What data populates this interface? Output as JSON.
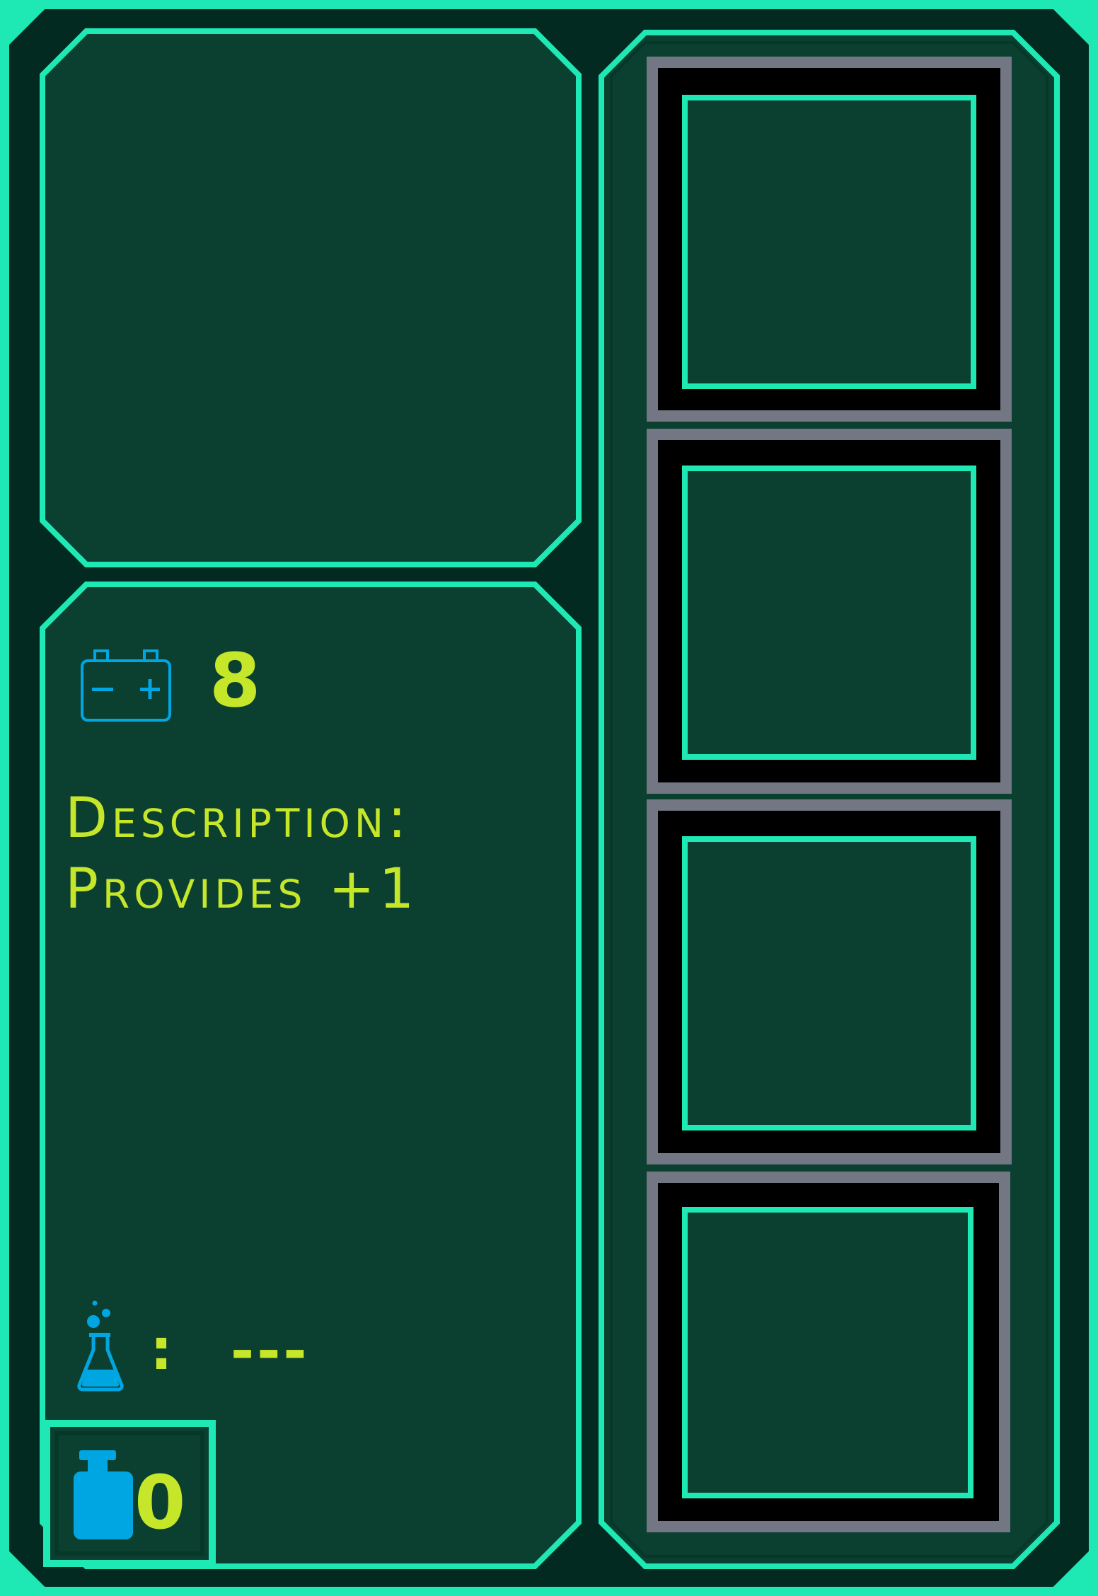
{
  "card": {
    "energy": {
      "icon": "battery-icon",
      "value": "8"
    },
    "description": {
      "label": "Description:",
      "text": "Provides +1"
    },
    "research": {
      "icon": "flask-icon",
      "separator": ":",
      "value": "---"
    },
    "mass": {
      "icon": "weight-icon",
      "value": "0"
    }
  },
  "slots": [
    {
      "name": "slot-1"
    },
    {
      "name": "slot-2"
    },
    {
      "name": "slot-3"
    },
    {
      "name": "slot-4"
    }
  ],
  "colors": {
    "neon": "#1ee8b4",
    "panel": "#0b4030",
    "dark": "#022a20",
    "text": "#c6e62a",
    "icon": "#00a6e2",
    "slot_frame": "#737783"
  }
}
